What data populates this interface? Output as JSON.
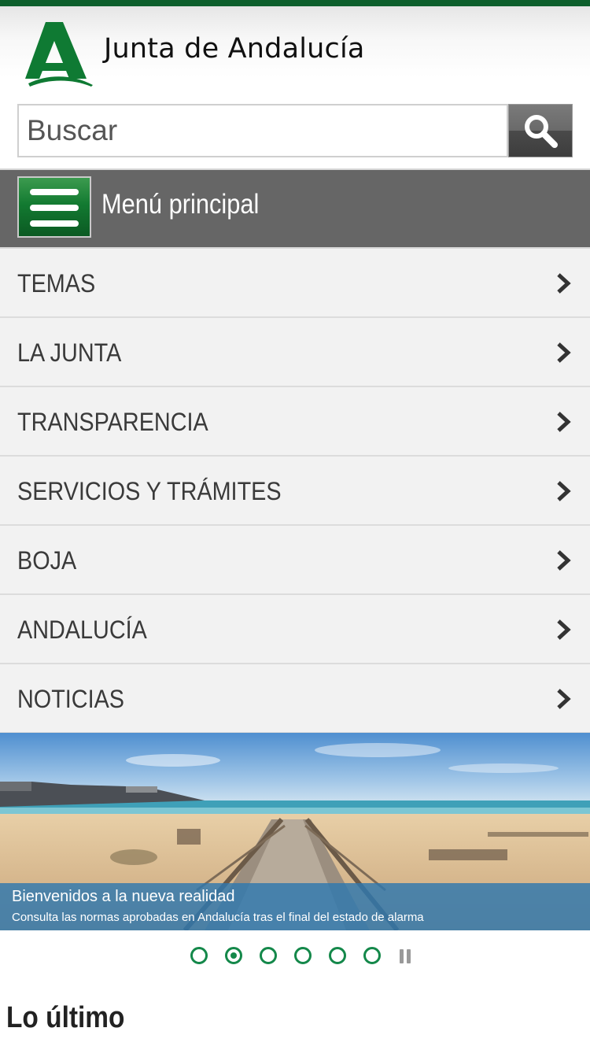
{
  "header": {
    "brand_name": "Junta de Andalucía",
    "logo_icon": "junta-andalucia-logo-icon"
  },
  "search": {
    "placeholder": "Buscar",
    "value": "",
    "button_icon": "search-icon"
  },
  "menu": {
    "title": "Menú principal",
    "toggle_icon": "hamburger-menu-icon",
    "items": [
      {
        "label": "TEMAS",
        "icon": "chevron-right-icon"
      },
      {
        "label": "LA JUNTA",
        "icon": "chevron-right-icon"
      },
      {
        "label": "TRANSPARENCIA",
        "icon": "chevron-right-icon"
      },
      {
        "label": "SERVICIOS Y TRÁMITES",
        "icon": "chevron-right-icon"
      },
      {
        "label": "BOJA",
        "icon": "chevron-right-icon"
      },
      {
        "label": "ANDALUCÍA",
        "icon": "chevron-right-icon"
      },
      {
        "label": "NOTICIAS",
        "icon": "chevron-right-icon"
      }
    ]
  },
  "carousel": {
    "slide_title": "Bienvenidos a la nueva realidad",
    "slide_subtitle": "Consulta las normas aprobadas en Andalucía tras el final del estado de alarma",
    "slide_count": 6,
    "active_slide": 2,
    "pause_icon": "pause-icon"
  },
  "latest": {
    "title": "Lo último"
  },
  "colors": {
    "brand_green": "#0d5f2c",
    "accent_green": "#14884a",
    "menu_bar": "#666666",
    "nav_background": "#f2f2f2",
    "caption_blue": "#2e78af"
  }
}
